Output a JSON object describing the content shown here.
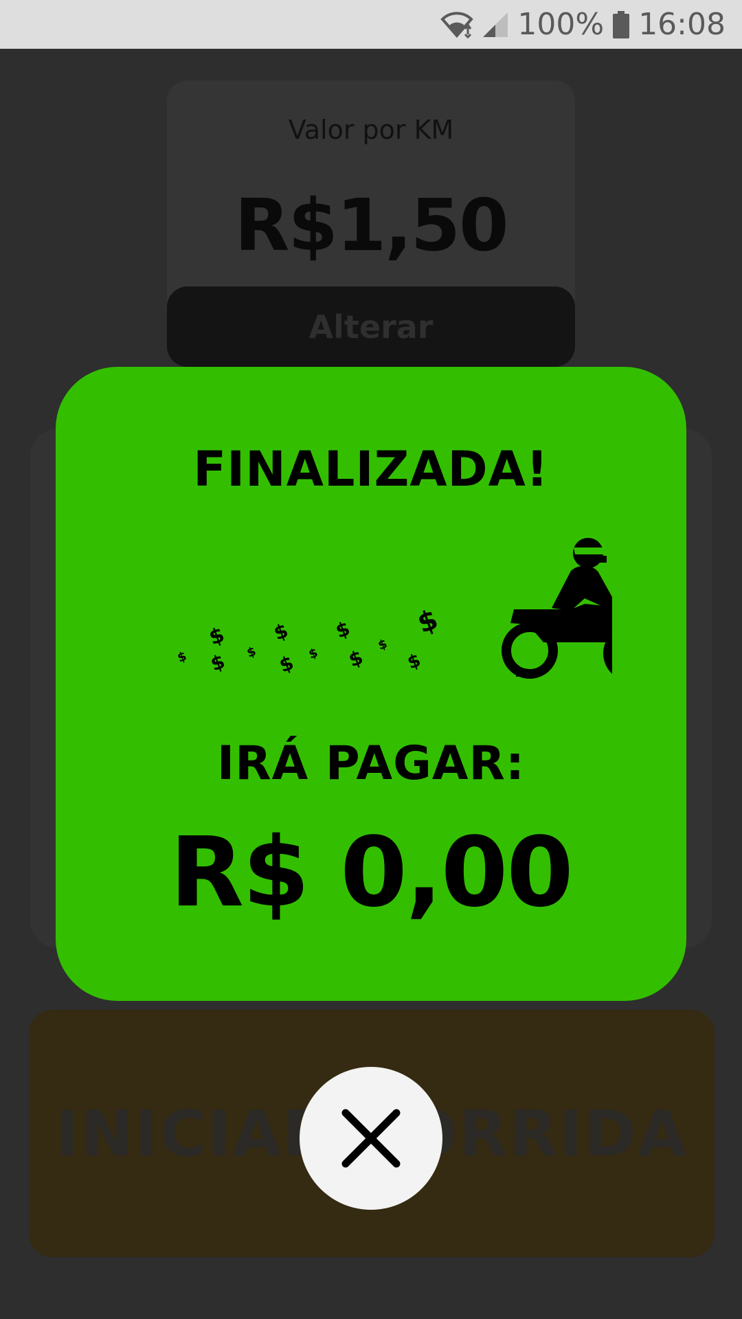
{
  "status_bar": {
    "battery_text": "100%",
    "time": "16:08",
    "icons": [
      "wifi-icon",
      "signal-icon",
      "battery-icon"
    ]
  },
  "km_card": {
    "label": "Valor por KM",
    "value": "R$1,50",
    "change_label": "Alterar"
  },
  "start_button": {
    "label": "INICIAR CORRIDA"
  },
  "modal": {
    "title": "FINALIZADA!",
    "pay_label": "IRÁ PAGAR:",
    "pay_value": "R$ 0,00",
    "background_color": "#33bf00",
    "illustration": "motorcycle-money-icon",
    "money_symbol": "$"
  },
  "close_button": {
    "icon": "close-icon"
  }
}
